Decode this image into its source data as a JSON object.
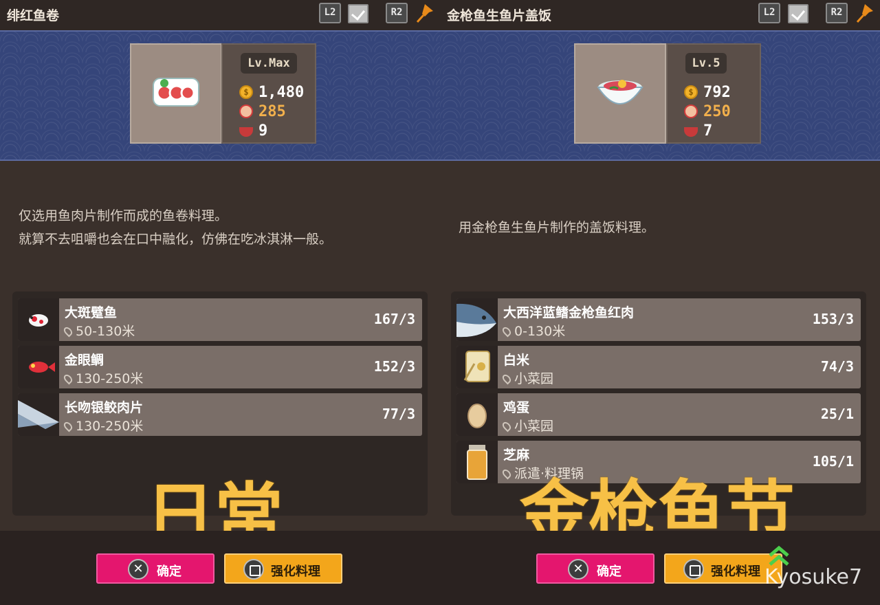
{
  "panels": [
    {
      "title": "绯红鱼卷",
      "buttons": {
        "l2": "L2",
        "r2": "R2"
      },
      "level": "Lv.Max",
      "stats": {
        "price": "1,480",
        "taste": "285",
        "portions": "9"
      },
      "description": [
        "仅选用鱼肉片制作而成的鱼卷料理。",
        "就算不去咀嚼也会在口中融化，仿佛在吃冰淇淋一般。"
      ],
      "ingredients": [
        {
          "name": "大斑躄鱼",
          "location": "50-130米",
          "count": "167/3",
          "icon": "frogfish-icon"
        },
        {
          "name": "金眼鲷",
          "location": "130-250米",
          "count": "152/3",
          "icon": "alfonsino-icon"
        },
        {
          "name": "长吻银鲛肉片",
          "location": "130-250米",
          "count": "77/3",
          "icon": "chimaera-icon"
        }
      ],
      "confirm_label": "确定",
      "enhance_label": "强化料理",
      "caption": "日常"
    },
    {
      "title": "金枪鱼生鱼片盖饭",
      "buttons": {
        "l2": "L2",
        "r2": "R2"
      },
      "level": "Lv.5",
      "stats": {
        "price": "792",
        "taste": "250",
        "portions": "7"
      },
      "description": [
        "用金枪鱼生鱼片制作的盖饭料理。"
      ],
      "ingredients": [
        {
          "name": "大西洋蓝鳍金枪鱼红肉",
          "location": "0-130米",
          "count": "153/3",
          "icon": "tuna-icon"
        },
        {
          "name": "白米",
          "location": "小菜园",
          "count": "74/3",
          "icon": "rice-bag-icon"
        },
        {
          "name": "鸡蛋",
          "location": "小菜园",
          "count": "25/1",
          "icon": "egg-icon"
        },
        {
          "name": "芝麻",
          "location": "派遣·料理锅",
          "count": "105/1",
          "icon": "sesame-jar-icon"
        }
      ],
      "confirm_label": "确定",
      "enhance_label": "强化料理",
      "caption": "金枪鱼节"
    }
  ],
  "watermark": "Kyosuke7",
  "colors": {
    "banner": "#35457a",
    "confirm": "#e4166e",
    "enhance": "#f3a61b",
    "caption": "#f7c046"
  }
}
